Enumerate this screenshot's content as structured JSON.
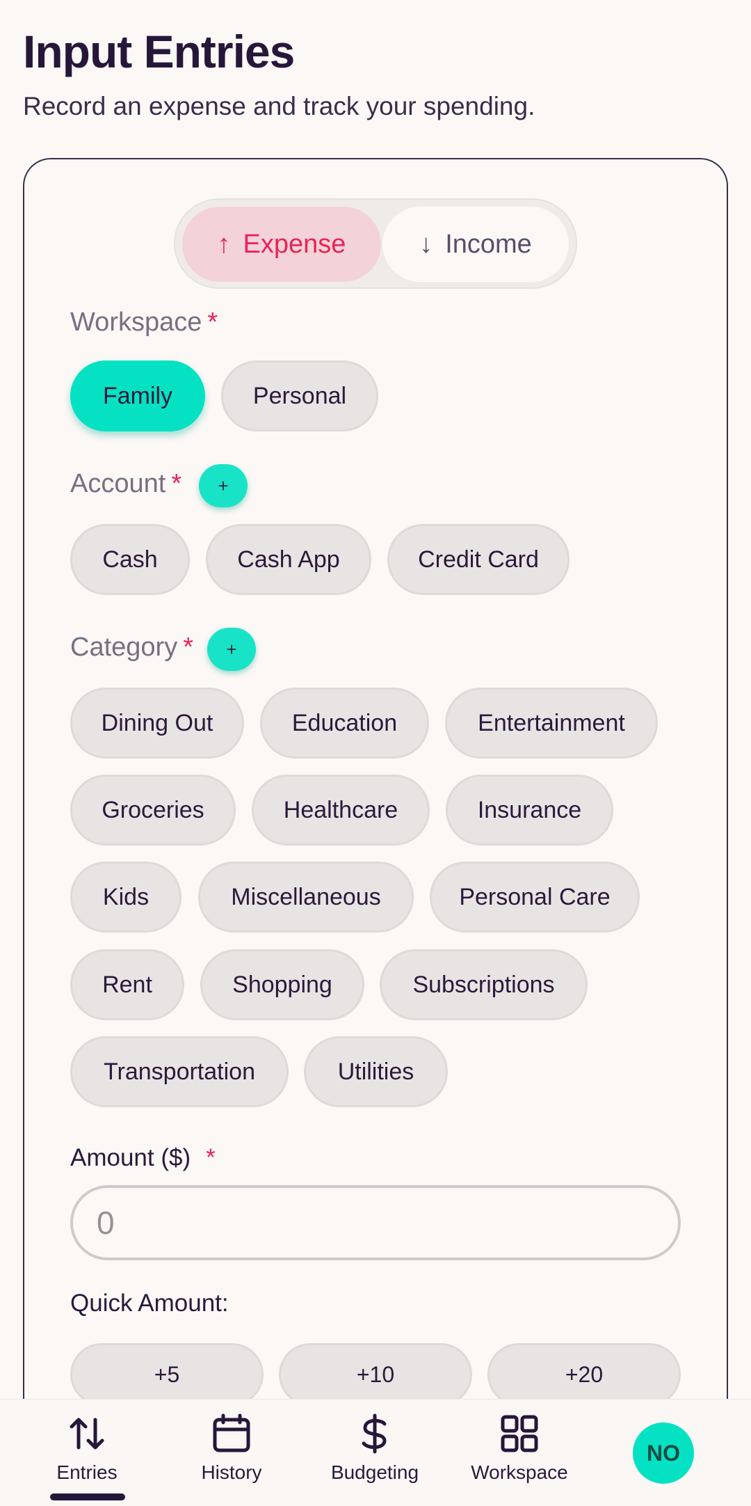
{
  "page": {
    "title": "Input Entries",
    "subtitle": "Record an expense and track your spending."
  },
  "type_toggle": {
    "expense_label": "Expense",
    "income_label": "Income",
    "selected": "Expense",
    "expense_icon": "arrow-up-icon",
    "income_icon": "arrow-down-icon"
  },
  "workspace": {
    "label": "Workspace",
    "required_mark": "*",
    "options": [
      "Family",
      "Personal"
    ],
    "selected": "Family"
  },
  "account": {
    "label": "Account",
    "required_mark": "*",
    "add_label": "+",
    "options": [
      "Cash",
      "Cash App",
      "Credit Card"
    ]
  },
  "category": {
    "label": "Category",
    "required_mark": "*",
    "add_label": "+",
    "options": [
      "Dining Out",
      "Education",
      "Entertainment",
      "Groceries",
      "Healthcare",
      "Insurance",
      "Kids",
      "Miscellaneous",
      "Personal Care",
      "Rent",
      "Shopping",
      "Subscriptions",
      "Transportation",
      "Utilities"
    ]
  },
  "amount": {
    "label": "Amount ($)",
    "required_mark": "*",
    "value": "",
    "placeholder": "0"
  },
  "quick_amount": {
    "label": "Quick Amount:",
    "options": [
      "+5",
      "+10",
      "+20"
    ]
  },
  "bottom_nav": {
    "items": [
      {
        "label": "Entries",
        "icon": "sort-arrows-icon",
        "active": true
      },
      {
        "label": "History",
        "icon": "calendar-icon",
        "active": false
      },
      {
        "label": "Budgeting",
        "icon": "dollar-icon",
        "active": false
      },
      {
        "label": "Workspace",
        "icon": "grid-icon",
        "active": false
      }
    ],
    "avatar_initials": "NO"
  },
  "colors": {
    "accent": "#05e2c3",
    "expense_red": "#e8245a",
    "expense_bg": "#f4d3d8",
    "background": "#fcf8f6",
    "text_dark": "#26173a"
  }
}
